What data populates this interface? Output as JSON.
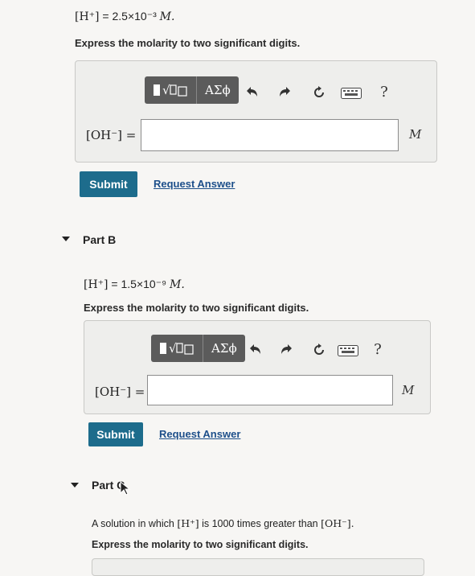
{
  "partA": {
    "conc_lhs": "[H⁺]",
    "conc_value": "= 2.5×10⁻³",
    "conc_unit": "M.",
    "prompt": "Express the molarity to two significant digits.",
    "toolbar": {
      "templates_icon": "templates-icon",
      "greek_label": "ΑΣϕ",
      "help_label": "?"
    },
    "answer_label": "[OH⁻] =",
    "answer_value": "",
    "unit": "M",
    "submit_label": "Submit",
    "request_label": "Request Answer"
  },
  "partB": {
    "title": "Part B",
    "conc_lhs": "[H⁺]",
    "conc_value": "= 1.5×10⁻⁹",
    "conc_unit": "M.",
    "prompt": "Express the molarity to two significant digits.",
    "toolbar": {
      "greek_label": "ΑΣϕ",
      "help_label": "?"
    },
    "answer_label": "[OH⁻] =",
    "answer_value": "",
    "unit": "M",
    "submit_label": "Submit",
    "request_label": "Request Answer"
  },
  "partC": {
    "title": "Part C",
    "statement_pre": "A solution in which",
    "statement_h": "[H⁺]",
    "statement_mid": "is 1000 times greater than",
    "statement_oh": "[OH⁻].",
    "prompt": "Express the molarity to two significant digits."
  },
  "icons": [
    "templates-icon",
    "greek-icon",
    "undo-icon",
    "redo-icon",
    "reset-icon",
    "keyboard-icon",
    "help-icon",
    "caret-down-icon",
    "mouse-pointer-icon"
  ]
}
